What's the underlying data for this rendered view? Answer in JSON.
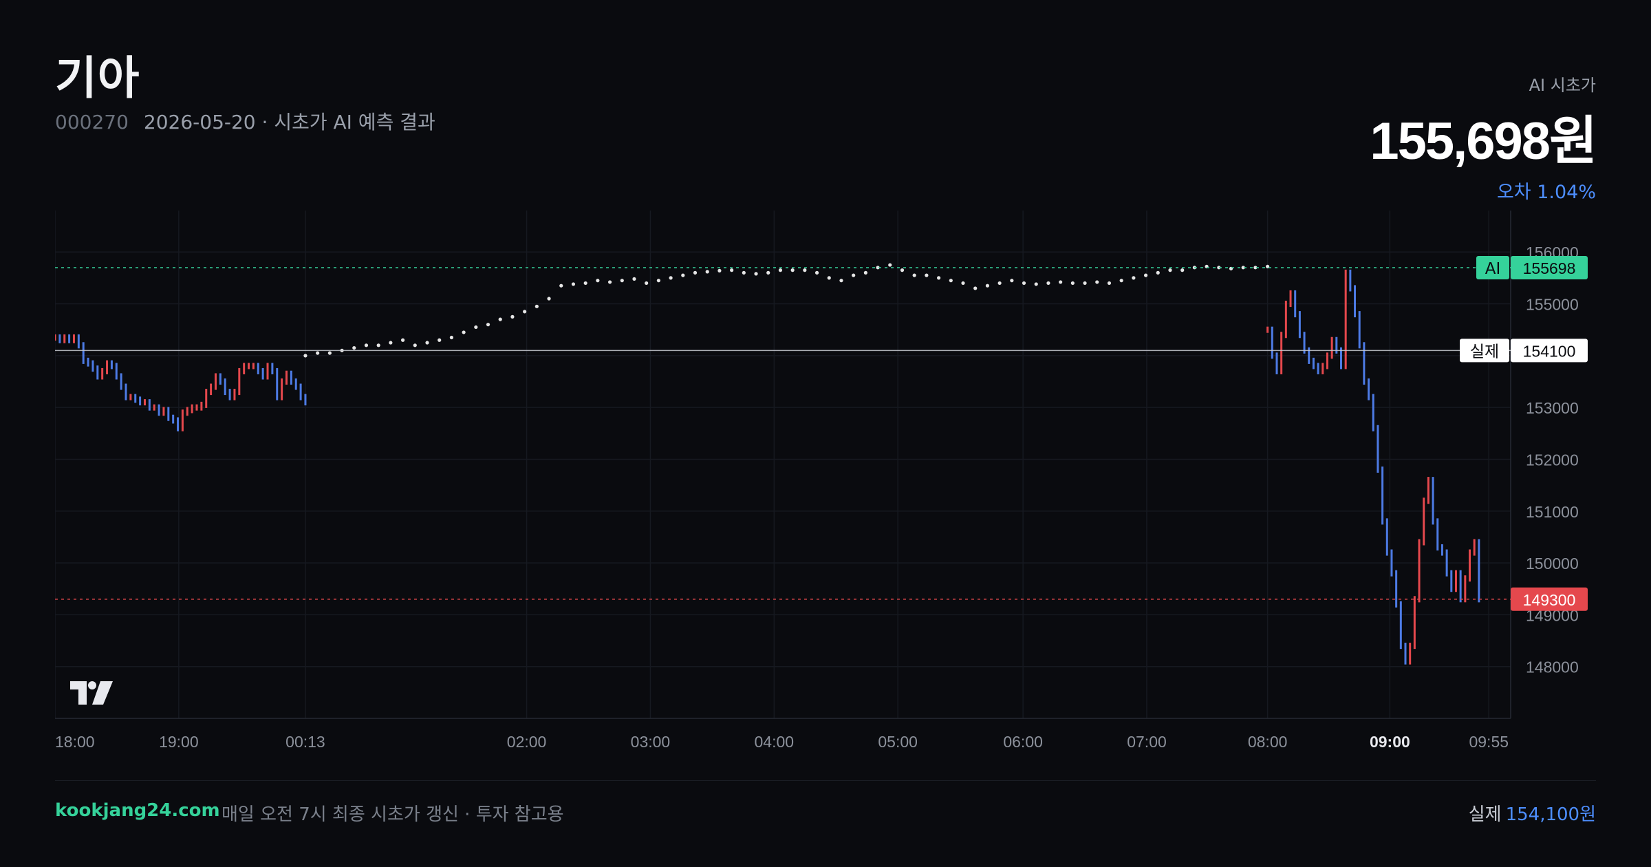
{
  "header": {
    "title": "기아",
    "code": "000270",
    "subtitle": "2026-05-20 · 시초가 AI 예측 결과",
    "ai_label": "AI 시초가",
    "ai_price": "155,698원",
    "error_text": "오차 1.04%"
  },
  "colors": {
    "background": "#0a0b0f",
    "up": "#e5484d",
    "down": "#4d7be5",
    "ai_line": "#35d29a",
    "actual_line": "#c9ccd3",
    "current_line": "#e5484d",
    "prediction_dots": "#e6e6e6",
    "accent_blue": "#4d8eff"
  },
  "chart_data": {
    "type": "line",
    "ylim": [
      147000,
      156800
    ],
    "y_ticks": [
      148000,
      149000,
      150000,
      151000,
      152000,
      153000,
      154000,
      155000,
      156000
    ],
    "x_ticks": [
      "18:00",
      "19:00",
      "00:13",
      "02:00",
      "03:00",
      "04:00",
      "05:00",
      "06:00",
      "07:00",
      "08:00",
      "09:00",
      "09:55"
    ],
    "x_ticks_bold": [
      "09:00"
    ],
    "grid": true,
    "reference_lines": [
      {
        "label": "AI",
        "value": 155698,
        "value_text": "155698",
        "style": "dotted",
        "color": "#35d29a"
      },
      {
        "label": "실제",
        "value": 154100,
        "value_text": "154100",
        "style": "solid",
        "color": "#c9ccd3"
      },
      {
        "label": "",
        "value": 149300,
        "value_text": "149300",
        "style": "dotted",
        "color": "#e5484d"
      }
    ],
    "series": [
      {
        "kind": "bars",
        "segment": "18:00-00:13",
        "start": 0.0,
        "end": 2.0,
        "values": [
          154350,
          154300,
          154350,
          154300,
          154350,
          154200,
          153900,
          153850,
          153750,
          153600,
          153700,
          153850,
          153800,
          153600,
          153400,
          153200,
          153200,
          153150,
          153100,
          153100,
          153000,
          153000,
          152900,
          152950,
          152800,
          152750,
          152600,
          152900,
          152950,
          153000,
          153000,
          153050,
          153300,
          153400,
          153600,
          153500,
          153300,
          153200,
          153300,
          153700,
          153800,
          153800,
          153800,
          153700,
          153600,
          153800,
          153700,
          153200,
          153500,
          153650,
          153500,
          153400,
          153200,
          153100
        ]
      },
      {
        "kind": "dots",
        "segment": "00:13-08:00",
        "start": 2.0,
        "end": 9.0,
        "values": [
          154000,
          154050,
          154050,
          154100,
          154150,
          154200,
          154200,
          154250,
          154300,
          154200,
          154250,
          154300,
          154350,
          154450,
          154550,
          154600,
          154700,
          154750,
          154850,
          154950,
          155100,
          155350,
          155380,
          155400,
          155450,
          155420,
          155450,
          155480,
          155400,
          155450,
          155500,
          155550,
          155600,
          155620,
          155640,
          155650,
          155600,
          155580,
          155600,
          155650,
          155650,
          155650,
          155600,
          155500,
          155450,
          155550,
          155600,
          155700,
          155750,
          155650,
          155550,
          155550,
          155500,
          155450,
          155400,
          155300,
          155350,
          155400,
          155450,
          155400,
          155380,
          155400,
          155420,
          155400,
          155400,
          155420,
          155400,
          155450,
          155500,
          155550,
          155600,
          155650,
          155650,
          155700,
          155720,
          155700,
          155680,
          155700,
          155700,
          155720
        ]
      },
      {
        "kind": "bars",
        "segment": "08:00-09:55",
        "start": 9.0,
        "end": 10.9,
        "values": [
          154500,
          154000,
          153700,
          154400,
          155000,
          155200,
          154800,
          154400,
          154100,
          153900,
          153800,
          153700,
          153800,
          154000,
          154300,
          154100,
          153800,
          155600,
          155300,
          154800,
          154200,
          153500,
          153200,
          152600,
          151800,
          150800,
          150200,
          149800,
          149200,
          148400,
          148100,
          148400,
          149300,
          150400,
          151200,
          151600,
          150800,
          150300,
          150200,
          149800,
          149500,
          149800,
          149300,
          149700,
          150200,
          150400,
          149300
        ]
      }
    ]
  },
  "footer": {
    "brand": "kookjang24.com",
    "note": "매일 오전 7시 최종 시초가 갱신 · 투자 참고용",
    "actual_label": "실제",
    "actual_value": "154,100원"
  }
}
